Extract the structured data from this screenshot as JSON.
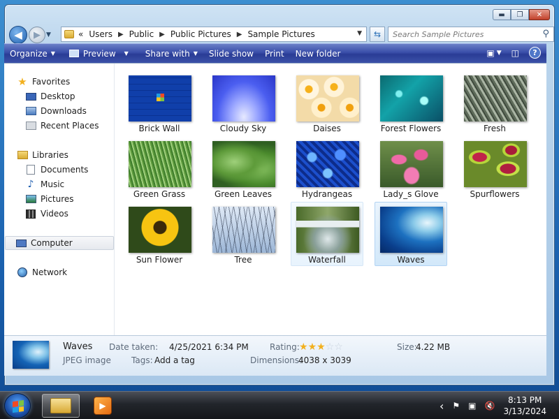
{
  "window": {
    "controls": {
      "minimize": "▬",
      "maximize": "❐",
      "close": "✕"
    }
  },
  "address_bar": {
    "overflow": "«",
    "breadcrumbs": [
      "Users",
      "Public",
      "Public Pictures",
      "Sample Pictures"
    ]
  },
  "search": {
    "placeholder": "Search Sample Pictures"
  },
  "toolbar": {
    "organize": "Organize",
    "preview": "Preview",
    "share_with": "Share with",
    "slide_show": "Slide show",
    "print": "Print",
    "new_folder": "New folder",
    "help": "?"
  },
  "nav_pane": {
    "favorites": "Favorites",
    "desktop": "Desktop",
    "downloads": "Downloads",
    "recent_places": "Recent Places",
    "libraries": "Libraries",
    "documents": "Documents",
    "music": "Music",
    "pictures": "Pictures",
    "videos": "Videos",
    "computer": "Computer",
    "network": "Network"
  },
  "files": [
    {
      "name": "Brick Wall",
      "thumb": "brick-wall"
    },
    {
      "name": "Cloudy Sky",
      "thumb": "cloudy-sky"
    },
    {
      "name": "Daises",
      "thumb": "daises"
    },
    {
      "name": "Forest Flowers",
      "thumb": "forest-flowers"
    },
    {
      "name": "Fresh",
      "thumb": "fresh"
    },
    {
      "name": "Green Grass",
      "thumb": "green-grass"
    },
    {
      "name": "Green Leaves",
      "thumb": "green-leaves"
    },
    {
      "name": "Hydrangeas",
      "thumb": "hydrangeas"
    },
    {
      "name": "Lady_s Glove",
      "thumb": "ladys-glove"
    },
    {
      "name": "Spurflowers",
      "thumb": "spurflowers"
    },
    {
      "name": "Sun Flower",
      "thumb": "sun-flower"
    },
    {
      "name": "Tree",
      "thumb": "tree"
    },
    {
      "name": "Waterfall",
      "thumb": "waterfall"
    },
    {
      "name": "Waves",
      "thumb": "waves"
    }
  ],
  "details": {
    "name": "Waves",
    "type": "JPEG image",
    "date_taken_label": "Date taken:",
    "date_taken": "4/25/2021 6:34 PM",
    "tags_label": "Tags:",
    "tags": "Add a tag",
    "rating_label": "Rating:",
    "rating": 3,
    "rating_max": 5,
    "dimensions_label": "Dimensions:",
    "dimensions": "4038 x 3039",
    "size_label": "Size:",
    "size": "4.22 MB"
  },
  "taskbar": {
    "tray_chevron": "‹",
    "time": "8:13 PM",
    "date": "3/13/2024"
  }
}
